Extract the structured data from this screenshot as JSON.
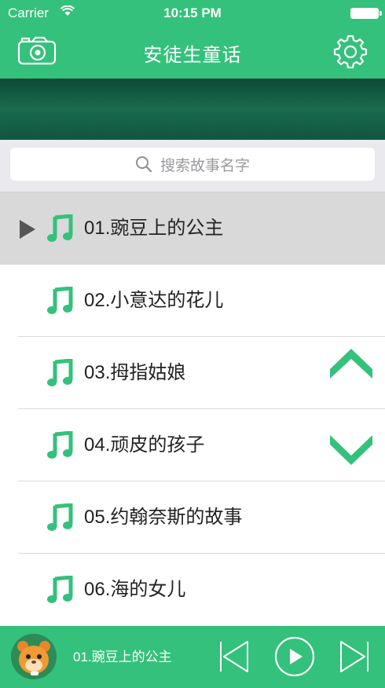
{
  "status_bar": {
    "carrier": "Carrier",
    "time": "10:15 PM"
  },
  "header": {
    "title": "安徒生童话"
  },
  "search": {
    "placeholder": "搜索故事名字"
  },
  "stories": [
    {
      "label": "01.豌豆上的公主",
      "selected": true
    },
    {
      "label": "02.小意达的花儿",
      "selected": false
    },
    {
      "label": "03.拇指姑娘",
      "selected": false
    },
    {
      "label": "04.顽皮的孩子",
      "selected": false
    },
    {
      "label": "05.约翰奈斯的故事",
      "selected": false
    },
    {
      "label": "06.海的女儿",
      "selected": false
    }
  ],
  "player": {
    "now_playing": "01.豌豆上的公主"
  },
  "colors": {
    "brand_green": "#34c17b",
    "note_green": "#34c17b",
    "selected_row": "#d9d9d9"
  },
  "icons": [
    "wifi-icon",
    "battery-icon",
    "camera-icon",
    "gear-icon",
    "search-icon",
    "play-indicator-icon",
    "music-note-icon",
    "chevron-up-icon",
    "chevron-down-icon",
    "previous-icon",
    "play-icon",
    "next-icon"
  ]
}
